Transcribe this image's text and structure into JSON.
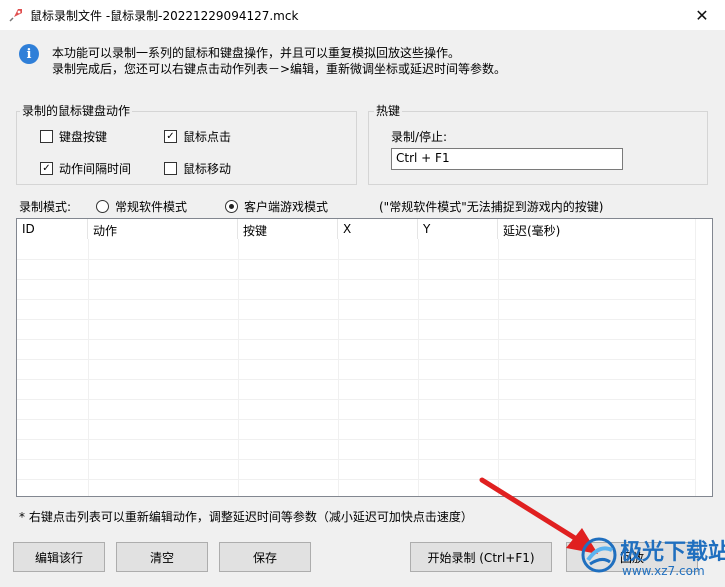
{
  "window": {
    "title": "鼠标录制文件 -鼠标录制-20221229094127.mck",
    "close_glyph": "✕"
  },
  "info": {
    "line1": "本功能可以录制一系列的鼠标和键盘操作，并且可以重复模拟回放这些操作。",
    "line2": "录制完成后，您还可以右键点击动作列表－>编辑，重新微调坐标或延迟时间等参数。"
  },
  "actions_group": {
    "title": "录制的鼠标键盘动作",
    "keyboard": {
      "label": "键盘按键",
      "checked": false
    },
    "mouse_click": {
      "label": "鼠标点击",
      "checked": true
    },
    "interval": {
      "label": "动作间隔时间",
      "checked": true
    },
    "mouse_move": {
      "label": "鼠标移动",
      "checked": false
    }
  },
  "hotkey_group": {
    "title": "热键",
    "label": "录制/停止:",
    "value": "Ctrl + F1"
  },
  "mode": {
    "label": "录制模式:",
    "options": [
      {
        "label": "常规软件模式",
        "selected": false
      },
      {
        "label": "客户端游戏模式",
        "selected": true
      }
    ],
    "hint": "(\"常规软件模式\"无法捕捉到游戏内的按键)"
  },
  "table": {
    "columns": [
      "ID",
      "动作",
      "按键",
      "X",
      "Y",
      "延迟(毫秒)"
    ],
    "rows": []
  },
  "footnote": "* 右键点击列表可以重新编辑动作，调整延迟时间等参数（减小延迟可加快点击速度）",
  "buttons": {
    "edit_row": "编辑该行",
    "clear": "清空",
    "save": "保存",
    "start_record": "开始录制 (Ctrl+F1)",
    "playback": "回放"
  },
  "annotation": {
    "arrow_color": "#e02020"
  },
  "watermark": {
    "brand": "极光下载站",
    "url": "www.xz7.com"
  }
}
